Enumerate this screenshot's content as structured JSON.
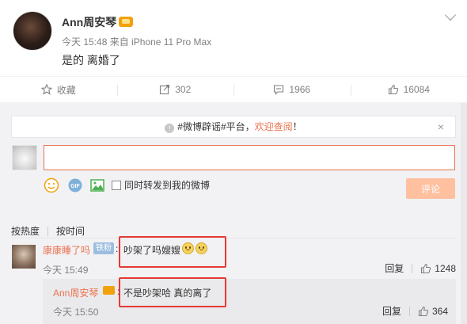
{
  "post": {
    "author": "Ann周安琴",
    "meta": "今天 15:48 来自 iPhone 11 Pro Max",
    "content": "是的 离婚了"
  },
  "actions": {
    "favorite": "收藏",
    "repost": "302",
    "comment": "1966",
    "like": "16084"
  },
  "notice": {
    "prefix": "#微博辟谣#平台，",
    "highlight": "欢迎查阅",
    "suffix": "！",
    "close": "×"
  },
  "compose": {
    "input_value": "",
    "forward_label": "同时转发到我的微博",
    "submit_label": "评论"
  },
  "sort": {
    "hot": "按热度",
    "time": "按时间"
  },
  "comments": [
    {
      "name": "康康睡了吗",
      "badge": "铁粉",
      "text": "吵架了吗嫂嫂",
      "time": "今天 15:49",
      "reply_label": "回复",
      "likes": "1248"
    }
  ],
  "reply": {
    "name": "Ann周安琴",
    "text": "不是吵架哈 真的离了",
    "time": "今天 15:50",
    "reply_label": "回复",
    "likes": "364"
  },
  "colors": {
    "accent": "#eb7350",
    "highlight_box": "#e53935",
    "submit_disabled": "#ffc09f"
  },
  "icons": [
    "chevron-down-icon",
    "star-icon",
    "repost-icon",
    "comment-icon",
    "thumb-up-icon",
    "emoji-icon",
    "gif-icon",
    "image-icon"
  ]
}
